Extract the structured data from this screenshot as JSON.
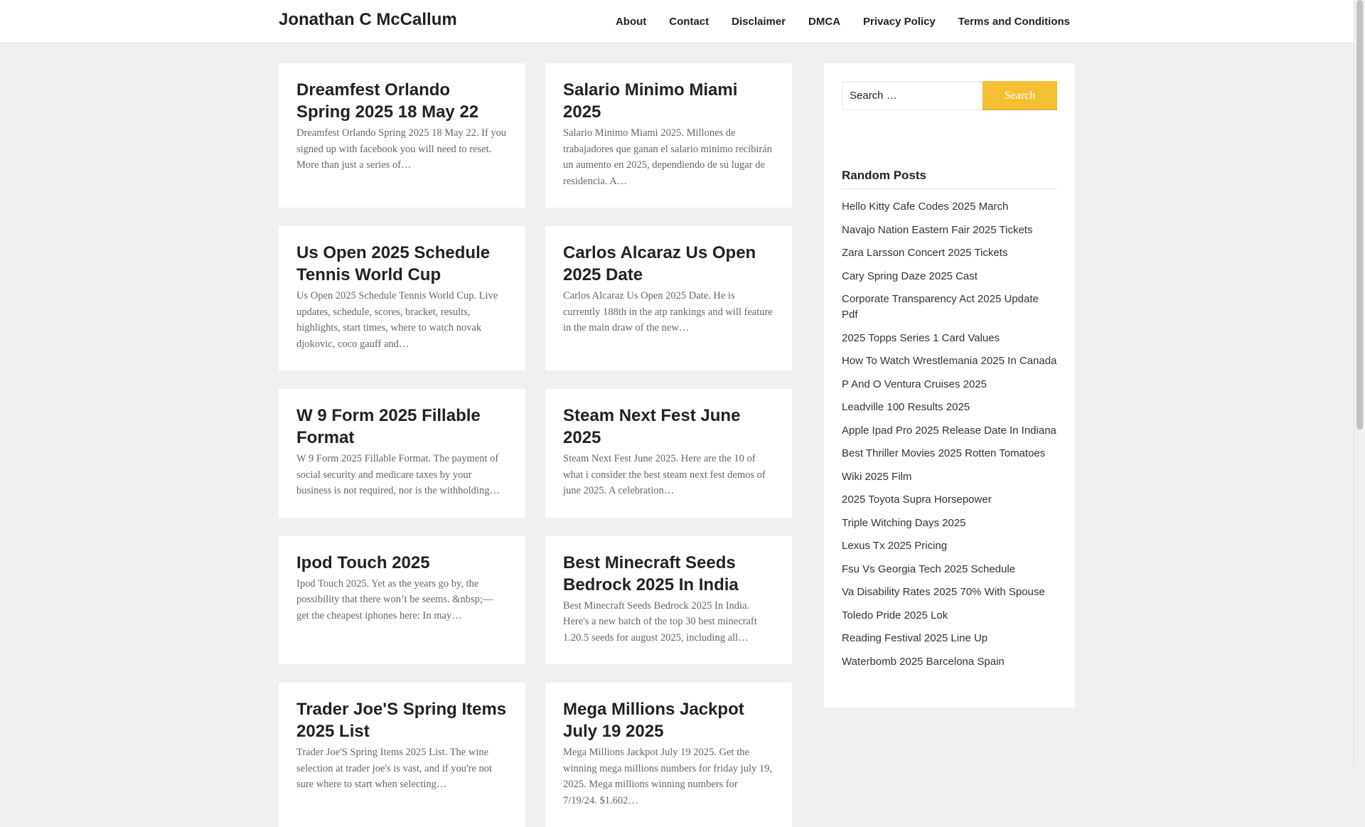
{
  "header": {
    "site_title": "Jonathan C McCallum",
    "nav": [
      "About",
      "Contact",
      "Disclaimer",
      "DMCA",
      "Privacy Policy",
      "Terms and Conditions"
    ]
  },
  "posts": [
    {
      "title": "Dreamfest Orlando Spring 2025 18 May 22",
      "excerpt": "Dreamfest Orlando Spring 2025 18 May 22. If you signed up with facebook you will need to reset. More than just a series of…"
    },
    {
      "title": "Salario Minimo Miami 2025",
      "excerpt": "Salario Minimo Miami 2025. Millones de trabajadores que ganan el salario minimo recibirán un aumento en 2025, dependiendo de su lugar de residencia. A…"
    },
    {
      "title": "Us Open 2025 Schedule Tennis World Cup",
      "excerpt": "Us Open 2025 Schedule Tennis World Cup. Live updates, schedule, scores, bracket, results, highlights, start times, where to watch novak djokovic, coco gauff and…"
    },
    {
      "title": "Carlos Alcaraz Us Open 2025 Date",
      "excerpt": "Carlos Alcaraz Us Open 2025 Date. He is currently 188th in the atp rankings and will feature in the main draw of the new…"
    },
    {
      "title": "W 9 Form 2025 Fillable Format",
      "excerpt": "W 9 Form 2025 Fillable Format. The payment of social security and medicare taxes by your business is not required, nor is the withholding…"
    },
    {
      "title": "Steam Next Fest June 2025",
      "excerpt": "Steam Next Fest June 2025. Here are the 10 of what i consider the best steam next fest demos of june 2025. A celebration…"
    },
    {
      "title": "Ipod Touch 2025",
      "excerpt": "Ipod Touch 2025. Yet as the years go by, the possibility that there won’t be seems. &nbsp;— get the cheapest iphones here: In may…"
    },
    {
      "title": "Best Minecraft Seeds Bedrock 2025 In India",
      "excerpt": "Best Minecraft Seeds Bedrock 2025 In India. Here's a new batch of the top 30 best minecraft 1.20.5 seeds for august 2025, including all…"
    },
    {
      "title": "Trader Joe'S Spring Items 2025 List",
      "excerpt": "Trader Joe'S Spring Items 2025 List. The wine selection at trader joe's is vast, and if you're not sure where to start when selecting…"
    },
    {
      "title": "Mega Millions Jackpot July 19 2025",
      "excerpt": "Mega Millions Jackpot July 19 2025. Get the winning mega millions numbers for friday july 19, 2025. Mega millions winning numbers for 7/19/24. $1.602…"
    }
  ],
  "sidebar": {
    "search_placeholder": "Search …",
    "search_button": "Search",
    "random_posts_title": "Random Posts",
    "random_posts": [
      "Hello Kitty Cafe Codes 2025 March",
      "Navajo Nation Eastern Fair 2025 Tickets",
      "Zara Larsson Concert 2025 Tickets",
      "Cary Spring Daze 2025 Cast",
      "Corporate Transparency Act 2025 Update Pdf",
      "2025 Topps Series 1 Card Values",
      "How To Watch Wrestlemania 2025 In Canada",
      "P And O Ventura Cruises 2025",
      "Leadville 100 Results 2025",
      "Apple Ipad Pro 2025 Release Date In Indiana",
      "Best Thriller Movies 2025 Rotten Tomatoes",
      "Wiki 2025 Film",
      "2025 Toyota Supra Horsepower",
      "Triple Witching Days 2025",
      "Lexus Tx 2025 Pricing",
      "Fsu Vs Georgia Tech 2025 Schedule",
      "Va Disability Rates 2025 70% With Spouse",
      "Toledo Pride 2025 Lok",
      "Reading Festival 2025 Line Up",
      "Waterbomb 2025 Barcelona Spain"
    ]
  },
  "colors": {
    "accent": "#f5bf34",
    "background": "#f0f0f0"
  }
}
